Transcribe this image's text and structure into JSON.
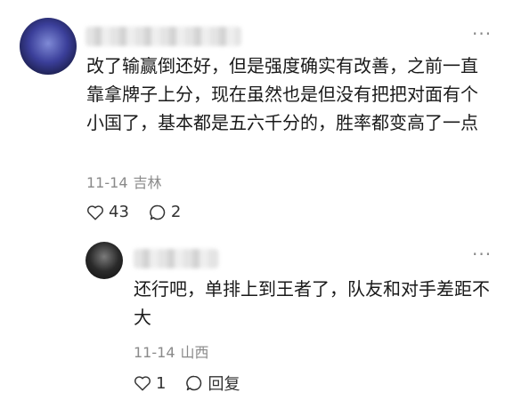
{
  "comment": {
    "text": "改了输赢倒还好，但是强度确实有改善，之前一直靠拿牌子上分，现在虽然也是但没有把把对面有个小国了，基本都是五六千分的，胜率都变高了一点",
    "date": "11-14",
    "location": "吉林",
    "likes": "43",
    "replies": "2",
    "more_icon": "more-dots-icon"
  },
  "reply": {
    "text": "还行吧，单排上到王者了，队友和对手差距不大",
    "date": "11-14",
    "location": "山西",
    "likes": "1",
    "reply_label": "回复",
    "more_icon": "more-dots-icon"
  }
}
